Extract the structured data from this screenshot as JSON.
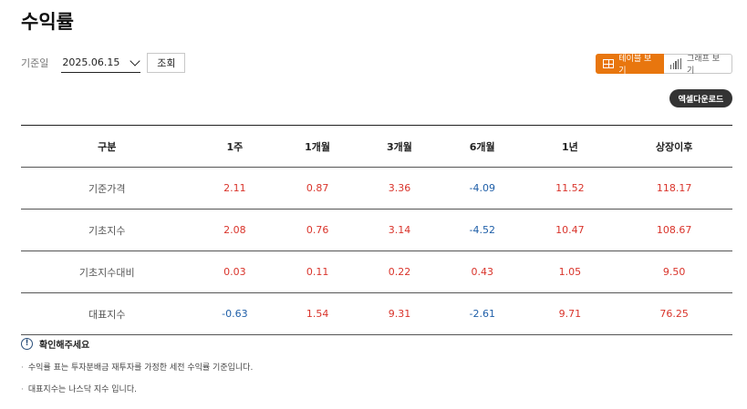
{
  "page": {
    "title": "수익률"
  },
  "filter": {
    "label": "기준일",
    "date_value": "2025.06.15",
    "query_button": "조회"
  },
  "view_toggle": {
    "table_label": "테이블 보기",
    "graph_label": "그래프 보기",
    "active": "table"
  },
  "excel_download": "엑셀다운로드",
  "table": {
    "headers": [
      "구분",
      "1주",
      "1개월",
      "3개월",
      "6개월",
      "1년",
      "상장이후"
    ],
    "rows": [
      {
        "label": "기준가격",
        "values": [
          "2.11",
          "0.87",
          "3.36",
          "-4.09",
          "11.52",
          "118.17"
        ]
      },
      {
        "label": "기초지수",
        "values": [
          "2.08",
          "0.76",
          "3.14",
          "-4.52",
          "10.47",
          "108.67"
        ]
      },
      {
        "label": "기초지수대비",
        "values": [
          "0.03",
          "0.11",
          "0.22",
          "0.43",
          "1.05",
          "9.50"
        ]
      },
      {
        "label": "대표지수",
        "values": [
          "-0.63",
          "1.54",
          "9.31",
          "-2.61",
          "9.71",
          "76.25"
        ]
      }
    ]
  },
  "notice": {
    "title": "확인해주세요",
    "icon": "info-icon",
    "items": [
      "수익률 표는 투자분배금 재투자를 가정한 세전 수익률 기준입니다.",
      "대표지수는 나스닥 지수 입니다."
    ]
  },
  "colors": {
    "accent": "#e8760e",
    "positive": "#d9342b",
    "negative": "#1f5fa8",
    "dark_button": "#333333"
  }
}
